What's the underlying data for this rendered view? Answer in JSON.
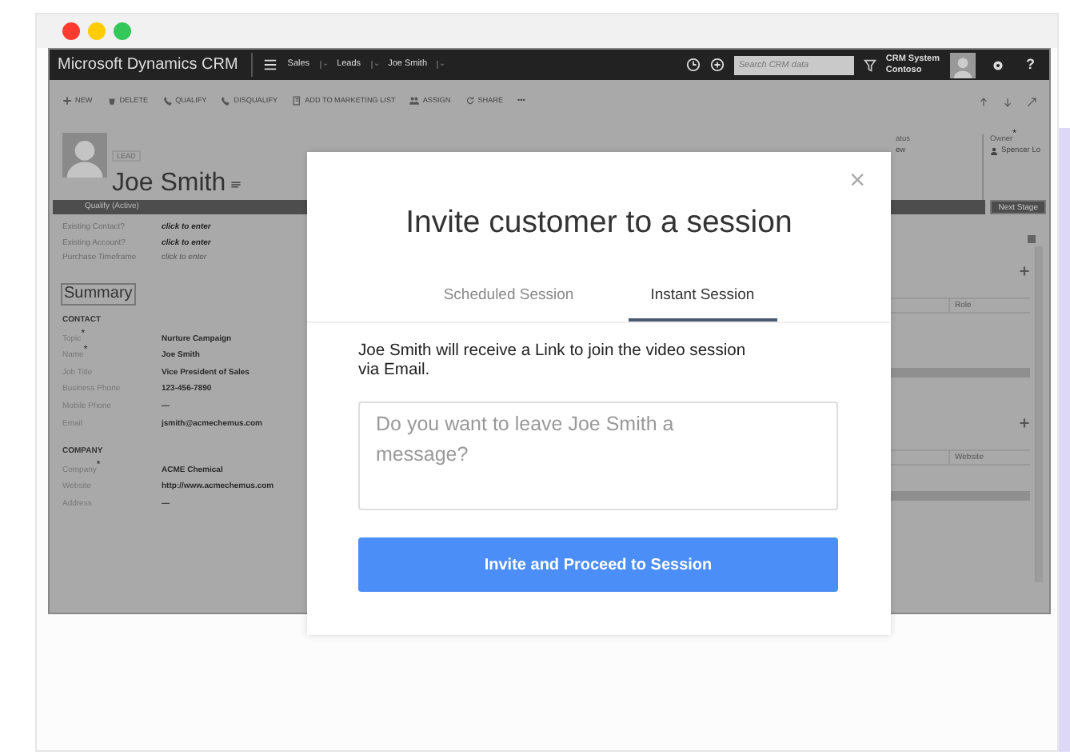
{
  "window": {
    "lights": [
      {
        "color": "#ff3b30"
      },
      {
        "color": "#ffcc00"
      },
      {
        "color": "#34c759"
      }
    ]
  },
  "crm": {
    "app_name": "Microsoft Dynamics CRM",
    "breadcrumbs": [
      "Sales",
      "Leads",
      "Joe Smith"
    ],
    "search": {
      "placeholder": "Search CRM data"
    },
    "user": {
      "name": "CRM System",
      "org": "Contoso"
    },
    "help": "?",
    "commands": [
      "NEW",
      "DELETE",
      "QUALIFY",
      "DISQUALIFY",
      "ADD TO MARKETING LIST",
      "ASSIGN",
      "SHARE",
      "•••"
    ],
    "record": {
      "type": "LEAD",
      "name": "Joe Smith"
    },
    "header_fields": [
      {
        "label": "atus",
        "value": "ew"
      },
      {
        "label": "Owner$^{*}$",
        "value": "Spencer Lo"
      }
    ],
    "stage": {
      "label": "Qualify (Active)",
      "next": "Next Stage"
    },
    "process_fields": [
      {
        "label": "Existing Contact?",
        "value": "click to enter",
        "emphasis": true
      },
      {
        "label": "Existing Account?",
        "value": "click to enter",
        "emphasis": true
      },
      {
        "label": "Purchase Timeframe",
        "value": "click to enter",
        "emphasis": false
      }
    ],
    "section_title": "Summary",
    "groups": [
      {
        "title": "CONTACT",
        "fields": [
          {
            "label": "Topic$^{*}$",
            "value": "Nurture Campaign"
          },
          {
            "label": "Name$^{*}$",
            "value": "Joe Smith"
          },
          {
            "label": "Job Title",
            "value": "Vice President of Sales"
          },
          {
            "label": "Business Phone",
            "value": "123-456-7890"
          },
          {
            "label": "Mobile Phone",
            "value": "—"
          },
          {
            "label": "Email",
            "value": "jsmith@acmechemus.com"
          }
        ]
      },
      {
        "title": "COMPANY",
        "fields": [
          {
            "label": "Company$^{*}$",
            "value": "ACME Chemical"
          },
          {
            "label": "Website",
            "value": "http://www.acmechemus.com"
          },
          {
            "label": "Address",
            "value": "—"
          }
        ]
      }
    ],
    "subgrids": [
      {
        "column": "Role"
      },
      {
        "column": "Website"
      }
    ]
  },
  "modal": {
    "close": "×",
    "title": "Invite customer to a session",
    "tabs": [
      {
        "label": "Scheduled Session",
        "selected": false
      },
      {
        "label": "Instant Session",
        "selected": true
      }
    ],
    "message": "Joe Smith will receive a Link to join the video session via Email.",
    "textarea": {
      "placeholder": "Do you want to leave Joe Smith a message?"
    },
    "button": "Invite and Proceed to Session"
  }
}
